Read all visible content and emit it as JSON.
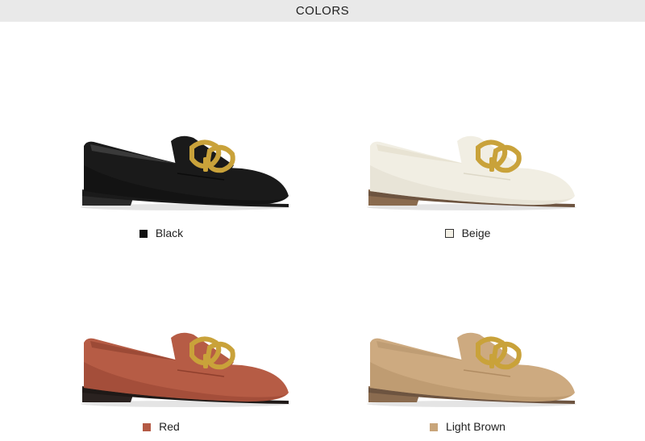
{
  "header": {
    "title": "COLORS"
  },
  "variants": [
    {
      "name": "Black",
      "swatch": "#111111",
      "upper": "#1a1a1a",
      "upper_shade": "#0c0c0c",
      "lining": "#3a3a3a",
      "heel": "#2a2a2a",
      "sole": "#1a1a1a"
    },
    {
      "name": "Beige",
      "swatch": "#f3f0e6",
      "upper": "#f1eee3",
      "upper_shade": "#ddd8c7",
      "lining": "#e8e3d3",
      "heel": "#8a6b4f",
      "sole": "#6d5440"
    },
    {
      "name": "Red",
      "swatch": "#b45a45",
      "upper": "#b65c45",
      "upper_shade": "#8f3f2d",
      "lining": "#9c4a36",
      "heel": "#2a2220",
      "sole": "#1f1917"
    },
    {
      "name": "Light Brown",
      "swatch": "#c8a57a",
      "upper": "#cdaa80",
      "upper_shade": "#b08c62",
      "lining": "#bf9d74",
      "heel": "#8a6b4f",
      "sole": "#6d5440"
    }
  ],
  "buckle_color": "#c9a23a"
}
